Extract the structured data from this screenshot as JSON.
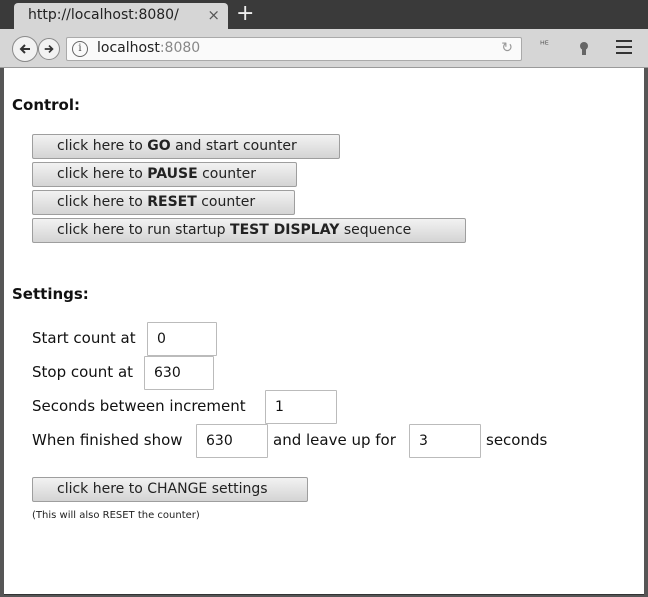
{
  "browser": {
    "tab_title": "http://localhost:8080/",
    "tab_close": "×",
    "new_tab": "+",
    "url_host": "localhost",
    "url_port": ":8080",
    "icons": [
      "back-icon",
      "forward-icon",
      "site-info-icon",
      "reload-icon",
      "translate-icon",
      "extension-icon",
      "menu-icon"
    ]
  },
  "control": {
    "heading": "Control:",
    "go": {
      "pre": "click here to ",
      "bold": "GO",
      "post": " and start counter"
    },
    "pause": {
      "pre": "click here to ",
      "bold": "PAUSE",
      "post": " counter"
    },
    "reset": {
      "pre": "click here to ",
      "bold": "RESET",
      "post": " counter"
    },
    "test": {
      "pre": "click here to run startup ",
      "bold": "TEST DISPLAY",
      "post": " sequence"
    }
  },
  "settings": {
    "heading": "Settings:",
    "start_label": "Start count at",
    "start_value": "0",
    "stop_label": "Stop count at",
    "stop_value": "630",
    "seconds_label": "Seconds between increment",
    "seconds_value": "1",
    "finished_label": "When finished show",
    "finished_value": "630",
    "leave_label": "and leave up for",
    "leave_value": "3",
    "seconds_suffix": "seconds",
    "change_button": "click here to CHANGE settings",
    "note": "(This will also RESET the counter)"
  }
}
